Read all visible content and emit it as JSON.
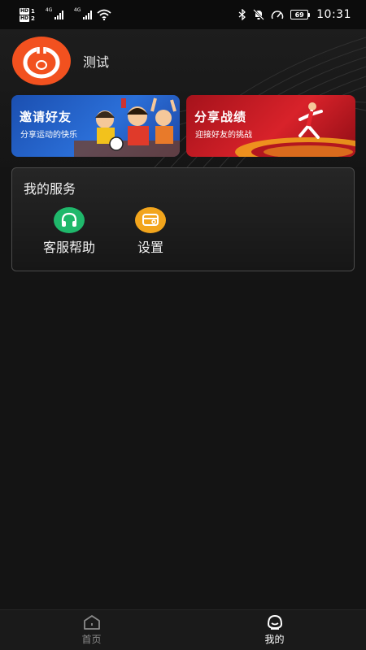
{
  "status_bar": {
    "sim1_label": "HD",
    "sim1_index": "1",
    "sim2_label": "HD",
    "sim2_index": "2",
    "network1": "4G",
    "network2": "4G",
    "battery": "69",
    "time": "10:31",
    "icons": [
      "bluetooth-icon",
      "mute-bell-icon",
      "speed-gauge-icon",
      "wifi-icon"
    ]
  },
  "profile": {
    "username": "测试",
    "avatar_icon": "app-logo-icon"
  },
  "banners": {
    "invite": {
      "title": "邀请好友",
      "subtitle": "分享运动的快乐"
    },
    "share": {
      "title": "分享战绩",
      "subtitle": "迎接好友的挑战"
    }
  },
  "services": {
    "title": "我的服务",
    "items": [
      {
        "label": "客服帮助",
        "icon": "headset-icon",
        "color": "#1fb86b"
      },
      {
        "label": "设置",
        "icon": "settings-card-icon",
        "color": "#f2a51c"
      }
    ]
  },
  "bottom_nav": {
    "items": [
      {
        "label": "首页",
        "icon": "home-icon",
        "active": false
      },
      {
        "label": "我的",
        "icon": "profile-face-icon",
        "active": true
      }
    ]
  },
  "colors": {
    "background": "#141414",
    "accent_orange": "#f2511f",
    "invite_banner": "#2b6fd8",
    "share_banner": "#d8222a"
  }
}
